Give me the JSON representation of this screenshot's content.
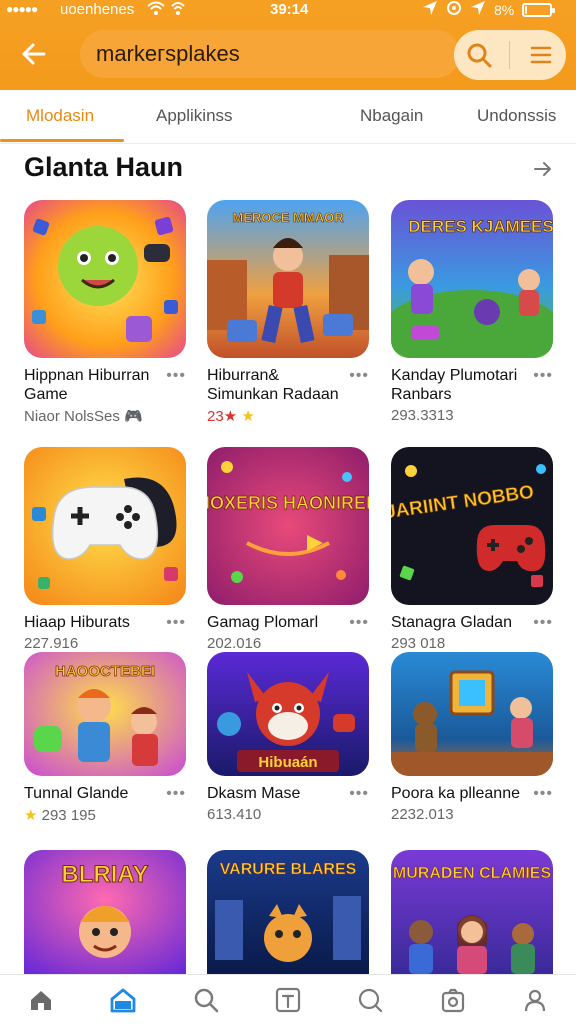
{
  "status_bar": {
    "carrier": "uoenhenes",
    "time": "39:14",
    "battery": "8%",
    "battery_level": 0.08
  },
  "header": {
    "back_icon": "arrow-left-icon",
    "search_value": "markeгsplakes",
    "search_icon": "search-icon",
    "menu_icon": "list-icon",
    "accent": "#f39a1c"
  },
  "tabs": [
    {
      "label": "Mlоdasin",
      "active": true
    },
    {
      "label": "Applikinss",
      "active": false
    },
    {
      "label": "Nbagain",
      "active": false
    },
    {
      "label": "Undonssis",
      "active": false
    }
  ],
  "section": {
    "title": "Glanta Haun",
    "more_icon": "chevron-right-icon"
  },
  "apps": [
    {
      "title": "Hippnan Hiburran Game",
      "meta": "Niaor NolsSes",
      "badge": "🎮"
    },
    {
      "title": "Hiburran& Simunkan Radaan",
      "meta": "23★",
      "star": "★"
    },
    {
      "title": "Kanday Plumotari Ranbars",
      "meta": "293.3313"
    },
    {
      "title": "Hiaap Hiburats",
      "meta": "227.916"
    },
    {
      "title": "Gamag Plomarl",
      "meta": "202.016"
    },
    {
      "title": "Stanagra Gladan",
      "meta": "293 018"
    },
    {
      "title": "Tunnal Glande",
      "meta": "293 195",
      "star": "★"
    },
    {
      "title": "Dkasm Mase",
      "meta": "613.410"
    },
    {
      "title": "Poora ka plleanne",
      "meta": "2232.013"
    },
    {
      "title": "",
      "meta": ""
    },
    {
      "title": "",
      "meta": ""
    },
    {
      "title": "",
      "meta": ""
    }
  ],
  "thumb_text": [
    "",
    "MEROCE MMAOR",
    "DERES KJAMEES",
    "",
    "MOXERIS HAONIREM",
    "TUARIINT NOBBO",
    "HAOOCTEBEI",
    "Hibuaán",
    "",
    "BLRIAY",
    "VARURE BLARES",
    "MURADEN CLAMIES"
  ],
  "more_label": "•••",
  "bottom_nav": [
    {
      "icon": "home-icon",
      "active": false
    },
    {
      "icon": "store-icon",
      "active": true
    },
    {
      "icon": "search-icon",
      "active": false
    },
    {
      "icon": "t-square-icon",
      "active": false
    },
    {
      "icon": "magnifier-icon",
      "active": false
    },
    {
      "icon": "camera-icon",
      "active": false
    },
    {
      "icon": "user-icon",
      "active": false
    }
  ],
  "colors": {
    "accent": "#f08f1a",
    "active_nav": "#1e88e5",
    "nav_inactive": "#7a7a7a"
  }
}
